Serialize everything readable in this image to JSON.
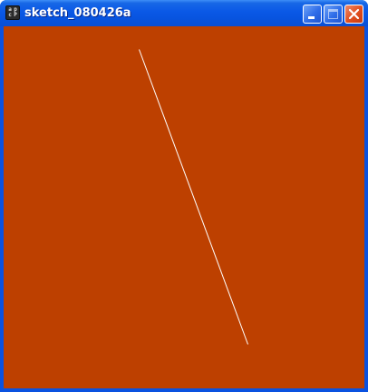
{
  "window": {
    "title": "sketch_080426a",
    "app_icon": "processing-icon",
    "app_icon_glyphs": [
      "a",
      "p",
      "c",
      "P"
    ]
  },
  "controls": {
    "minimize_icon": "minimize-icon",
    "maximize_icon": "maximize-icon",
    "close_icon": "close-icon"
  },
  "canvas": {
    "background_color": "#bd4000",
    "stroke_color": "#ffffff"
  },
  "colors": {
    "titlebar": "#0a58e6",
    "frame": "#0a52e0",
    "close_button": "#e04d1d"
  }
}
